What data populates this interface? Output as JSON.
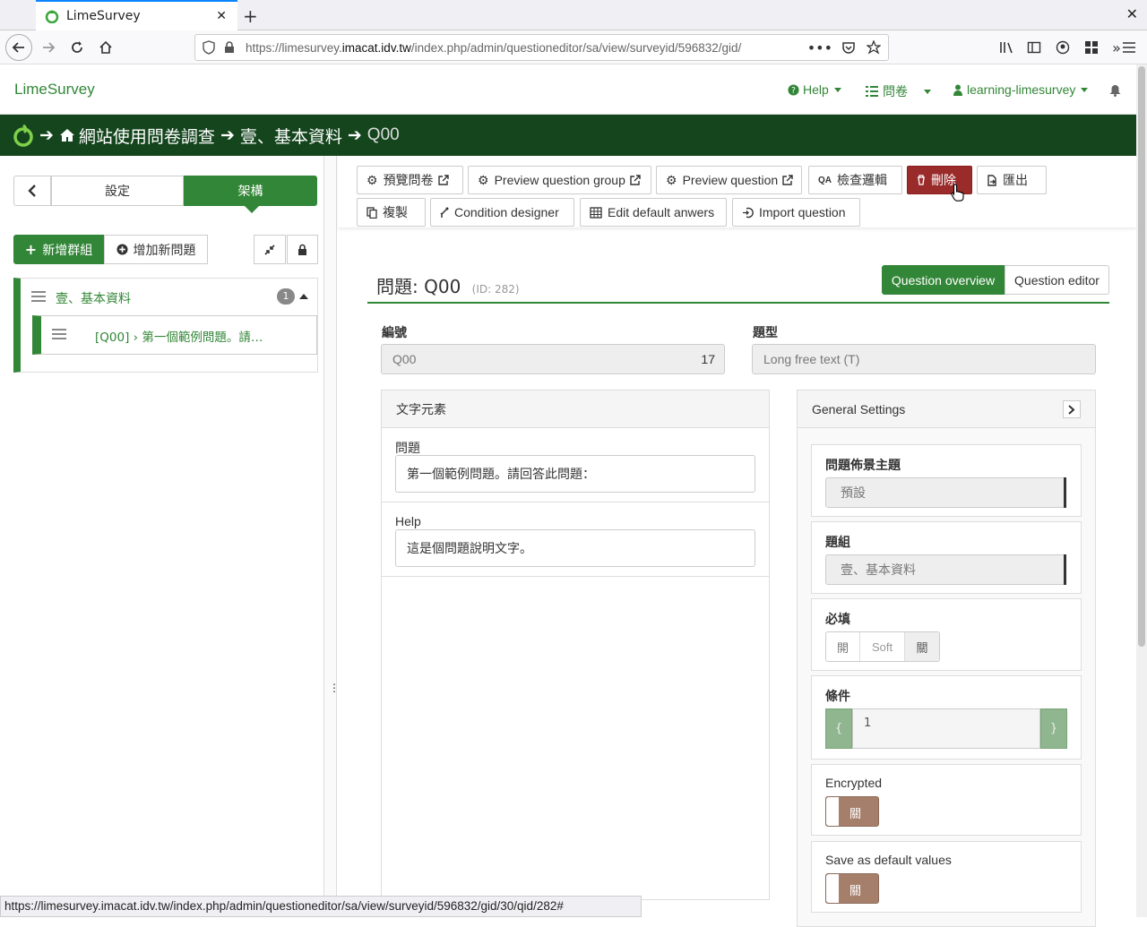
{
  "browser": {
    "tab_title": "LimeSurvey",
    "url_prefix": "https://limesurvey.",
    "url_domain": "imacat.idv.tw",
    "url_path": "/index.php/admin/questioneditor/sa/view/surveyid/596832/gid/",
    "status_url": "https://limesurvey.imacat.idv.tw/index.php/admin/questioneditor/sa/view/surveyid/596832/gid/30/qid/282#"
  },
  "header": {
    "brand": "LimeSurvey",
    "help": "Help",
    "surveys": "問卷",
    "user": "learning-limesurvey"
  },
  "breadcrumb": {
    "survey": "網站使用問卷調查",
    "group": "壹、基本資料",
    "question": "Q00"
  },
  "sidebar": {
    "tab_settings": "設定",
    "tab_structure": "架構",
    "add_group": "新增群組",
    "add_question": "增加新問題",
    "group_name": "壹、基本資料",
    "group_count": "1",
    "question_item": "[Q00] › 第一個範例問題。請…"
  },
  "toolbar": {
    "preview_survey": "預覽問卷",
    "preview_group": "Preview question group",
    "preview_question": "Preview question",
    "check_logic": "檢查邏輯",
    "delete": "刪除",
    "export": "匯出",
    "copy": "複製",
    "condition_designer": "Condition designer",
    "edit_defaults": "Edit default anwers",
    "import_question": "Import question"
  },
  "question": {
    "title_prefix": "問題:",
    "code": "Q00",
    "id_label": "(ID: 282)",
    "overview_btn": "Question overview",
    "editor_btn": "Question editor",
    "code_label": "編號",
    "code_value": "Q00",
    "code_counter": "17",
    "type_label": "題型",
    "type_value": "Long free text (T)"
  },
  "text_elements": {
    "heading": "文字元素",
    "question_label": "問題",
    "question_text": "第一個範例問題。請回答此問題：",
    "help_label": "Help",
    "help_text": "這是個問題說明文字。"
  },
  "general_settings": {
    "heading": "General Settings",
    "theme_label": "問題佈景主題",
    "theme_value": "預設",
    "group_label": "題組",
    "group_value": "壹、基本資料",
    "mandatory_label": "必填",
    "mandatory_options": [
      "開",
      "Soft",
      "關"
    ],
    "condition_label": "條件",
    "condition_value": "1",
    "condition_open": "{",
    "condition_close": "}",
    "encrypted_label": "Encrypted",
    "encrypted_value": "關",
    "save_default_label": "Save as default values",
    "save_default_value": "關"
  }
}
